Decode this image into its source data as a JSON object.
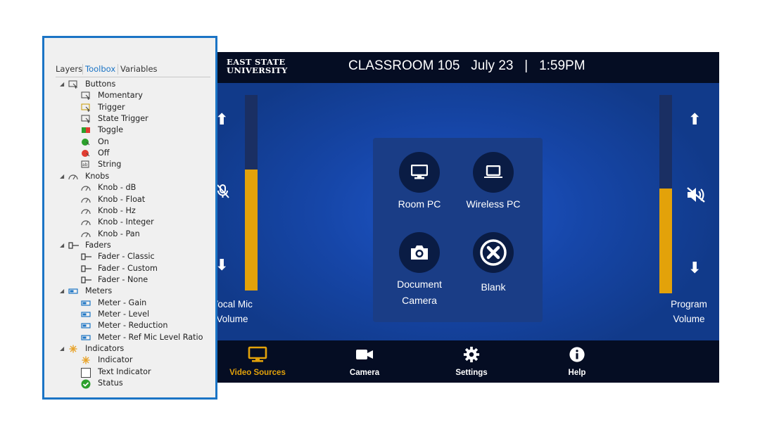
{
  "panel": {
    "logo_line1": "EAST STATE",
    "logo_line2": "UNIVERSITY",
    "room": "CLASSROOM 105",
    "date": "July 23",
    "separator": "|",
    "time": "1:59PM",
    "left_volume": {
      "label_line1": "Vocal Mic",
      "label_line2": "Volume",
      "level": 0.62,
      "muted": true
    },
    "right_volume": {
      "label_line1": "Program",
      "label_line2": "Volume",
      "level": 0.53,
      "muted": true
    },
    "arrows": {
      "up": "⬆",
      "down": "⬇"
    },
    "sources": [
      {
        "label_line1": "Room PC",
        "label_line2": "",
        "icon": "monitor-icon",
        "active": true
      },
      {
        "label_line1": "Wireless PC",
        "label_line2": "",
        "icon": "laptop-icon",
        "active": false
      },
      {
        "label_line1": "Document",
        "label_line2": "Camera",
        "icon": "camera-icon",
        "active": false
      },
      {
        "label_line1": "Blank",
        "label_line2": "",
        "icon": "close-circle-icon",
        "active": false
      }
    ],
    "nav": [
      {
        "label": "Video Sources",
        "icon": "monitor-icon",
        "active": true
      },
      {
        "label": "Camera",
        "icon": "video-camera-icon",
        "active": false
      },
      {
        "label": "Settings",
        "icon": "gear-icon",
        "active": false
      },
      {
        "label": "Help",
        "icon": "info-icon",
        "active": false
      }
    ],
    "colors": {
      "accent": "#e3a20a",
      "background": "#123a84",
      "bar": "#050d23"
    }
  },
  "toolbox": {
    "tabs": [
      {
        "label": "Layers",
        "active": false
      },
      {
        "label": "Toolbox",
        "active": true
      },
      {
        "label": "Variables",
        "active": false
      }
    ],
    "tree": [
      {
        "label": "Buttons",
        "level": 0,
        "icon": "button-icon"
      },
      {
        "label": "Momentary",
        "level": 1,
        "icon": "momentary-button-icon"
      },
      {
        "label": "Trigger",
        "level": 1,
        "icon": "trigger-button-icon"
      },
      {
        "label": "State Trigger",
        "level": 1,
        "icon": "state-trigger-button-icon"
      },
      {
        "label": "Toggle",
        "level": 1,
        "icon": "toggle-icon"
      },
      {
        "label": "On",
        "level": 1,
        "icon": "on-button-icon"
      },
      {
        "label": "Off",
        "level": 1,
        "icon": "off-button-icon"
      },
      {
        "label": "String",
        "level": 1,
        "icon": "string-button-icon"
      },
      {
        "label": "Knobs",
        "level": 0,
        "icon": "knob-icon"
      },
      {
        "label": "Knob - dB",
        "level": 1,
        "icon": "knob-icon"
      },
      {
        "label": "Knob - Float",
        "level": 1,
        "icon": "knob-icon"
      },
      {
        "label": "Knob - Hz",
        "level": 1,
        "icon": "knob-icon"
      },
      {
        "label": "Knob - Integer",
        "level": 1,
        "icon": "knob-icon"
      },
      {
        "label": "Knob - Pan",
        "level": 1,
        "icon": "knob-icon"
      },
      {
        "label": "Faders",
        "level": 0,
        "icon": "fader-icon"
      },
      {
        "label": "Fader - Classic",
        "level": 1,
        "icon": "fader-icon"
      },
      {
        "label": "Fader - Custom",
        "level": 1,
        "icon": "fader-icon"
      },
      {
        "label": "Fader - None",
        "level": 1,
        "icon": "fader-icon"
      },
      {
        "label": "Meters",
        "level": 0,
        "icon": "meter-icon"
      },
      {
        "label": "Meter - Gain",
        "level": 1,
        "icon": "meter-icon"
      },
      {
        "label": "Meter - Level",
        "level": 1,
        "icon": "meter-icon"
      },
      {
        "label": "Meter - Reduction",
        "level": 1,
        "icon": "meter-icon"
      },
      {
        "label": "Meter - Ref Mic Level Ratio",
        "level": 1,
        "icon": "meter-icon"
      },
      {
        "label": "Indicators",
        "level": 0,
        "icon": "indicator-icon"
      },
      {
        "label": "Indicator",
        "level": 1,
        "icon": "indicator-icon"
      },
      {
        "label": "Text Indicator",
        "level": 1,
        "icon": "text-indicator-icon"
      },
      {
        "label": "Status",
        "level": 1,
        "icon": "status-check-icon"
      }
    ]
  }
}
